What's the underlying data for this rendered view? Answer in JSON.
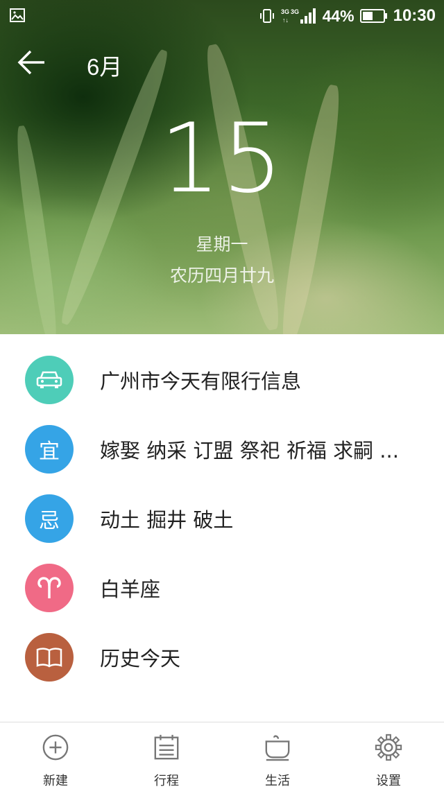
{
  "status_bar": {
    "network": "3G",
    "battery": "44%",
    "time": "10:30",
    "icons": [
      "gallery-icon",
      "vibrate-icon",
      "signal-icon",
      "battery-icon"
    ]
  },
  "header": {
    "month": "6月",
    "back_icon": "arrow-left-icon"
  },
  "date": {
    "day": "15",
    "weekday": "星期一",
    "lunar": "农历四月廿九"
  },
  "info_items": [
    {
      "icon": "car-icon",
      "glyph": "",
      "color": "#4ecdb8",
      "text": "广州市今天有限行信息"
    },
    {
      "icon": "yi-icon",
      "glyph": "宜",
      "color": "#35a4e6",
      "text": "嫁娶 纳采 订盟 祭祀 祈福 求嗣 ..."
    },
    {
      "icon": "ji-icon",
      "glyph": "忌",
      "color": "#35a4e6",
      "text": "动土 掘井 破土"
    },
    {
      "icon": "aries-icon",
      "glyph": "",
      "color": "#f06a86",
      "text": "白羊座"
    },
    {
      "icon": "book-icon",
      "glyph": "",
      "color": "#b9603f",
      "text": "历史今天"
    }
  ],
  "bottom_nav": [
    {
      "icon": "plus-circle-icon",
      "label": "新建"
    },
    {
      "icon": "calendar-list-icon",
      "label": "行程"
    },
    {
      "icon": "cup-icon",
      "label": "生活"
    },
    {
      "icon": "gear-icon",
      "label": "设置"
    }
  ]
}
